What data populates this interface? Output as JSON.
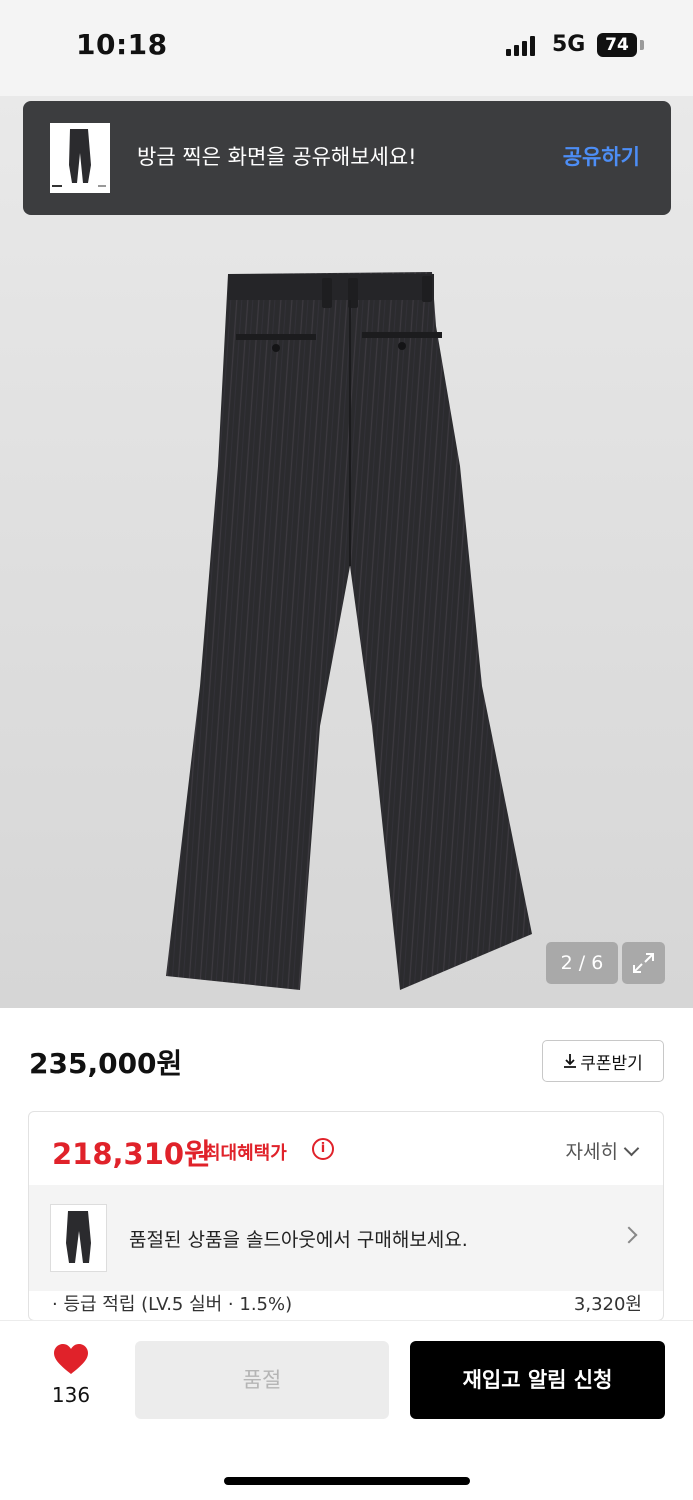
{
  "status_bar": {
    "time": "10:18",
    "network": "5G",
    "battery": "74"
  },
  "share_toast": {
    "message": "방금 찍은 화면을 공유해보세요!",
    "action": "공유하기"
  },
  "gallery": {
    "indicator": "2 / 6"
  },
  "price": {
    "original": "235,000원",
    "coupon_label": "쿠폰받기"
  },
  "benefit": {
    "price": "218,310원",
    "label": "최대혜택가",
    "detail_label": "자세히",
    "soldout_message": "품절된 상품을 솔드아웃에서 구매해보세요.",
    "reward_label": "· 등급 적립 (LV.5 실버 · 1.5%)",
    "reward_value": "3,320원"
  },
  "bottom_bar": {
    "like_count": "136",
    "soldout_label": "품절",
    "restock_label": "재입고 알림 신청"
  },
  "colors": {
    "accent_red": "#e0222a",
    "toast_link": "#4d8ef6",
    "toast_bg": "#3c3d3f"
  },
  "icons": [
    "signal-icon",
    "battery-icon",
    "expand-icon",
    "download-icon",
    "info-icon",
    "chevron-down-icon",
    "chevron-right-icon",
    "heart-icon"
  ]
}
